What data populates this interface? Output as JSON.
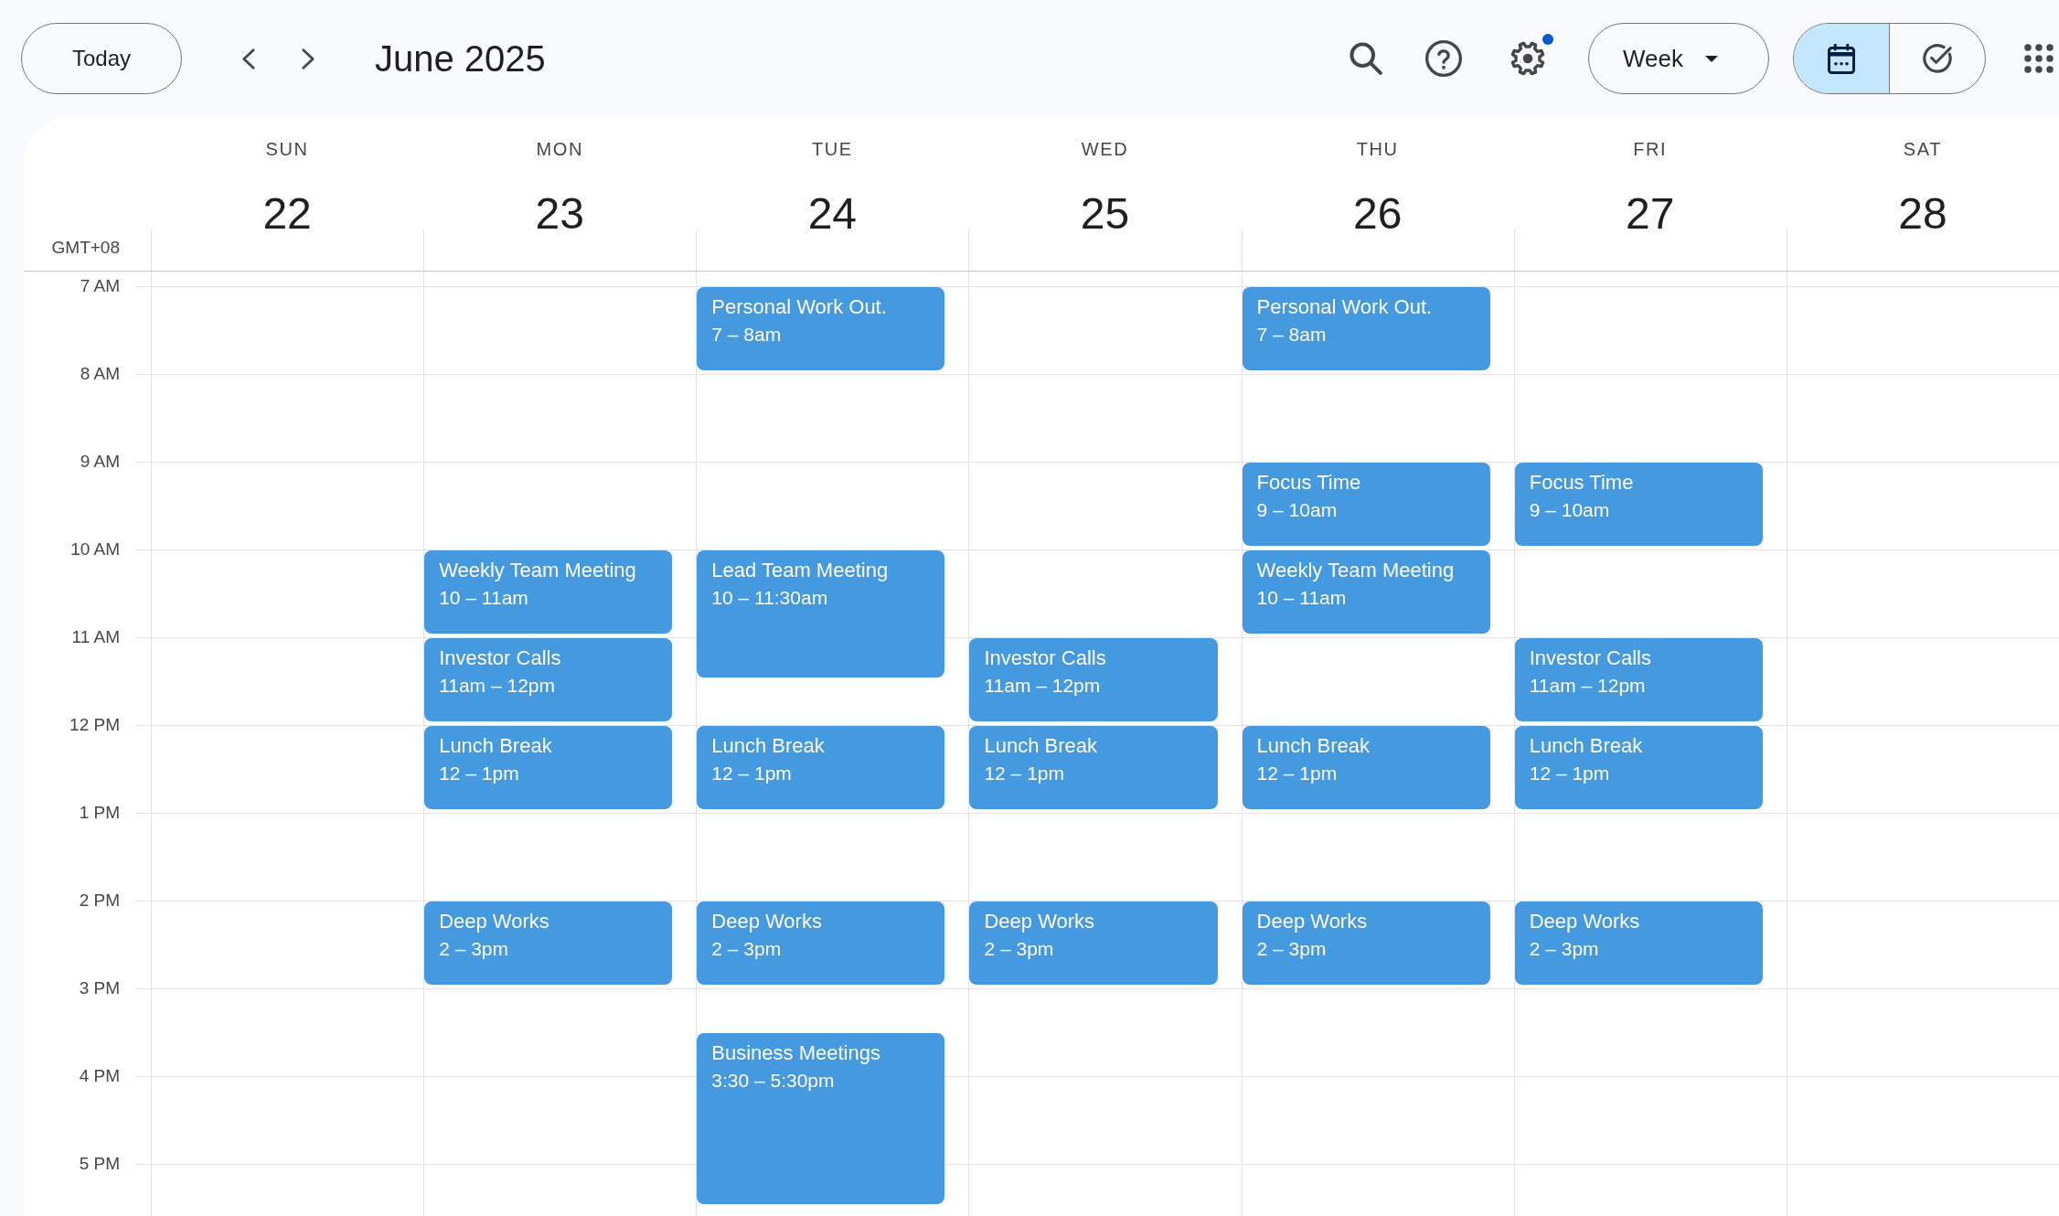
{
  "toolbar": {
    "today_button": "Today",
    "title": "June 2025",
    "settings_badge": true,
    "view_selector": "Week",
    "view_toggle": [
      {
        "kind": "calendar",
        "selected": true
      },
      {
        "kind": "tasks",
        "selected": false
      }
    ]
  },
  "timezone": "GMT+08",
  "hours": [
    "7 AM",
    "8 AM",
    "9 AM",
    "10 AM",
    "11 AM",
    "12 PM",
    "1 PM",
    "2 PM",
    "3 PM",
    "4 PM",
    "5 PM"
  ],
  "days": [
    {
      "weekday": "SUN",
      "date": "22"
    },
    {
      "weekday": "MON",
      "date": "23",
      "events": [
        {
          "title": "Weekly Team Meeting",
          "time": "10 – 11am"
        },
        {
          "title": "Investor Calls",
          "time": "11am – 12pm"
        },
        {
          "title": "Lunch Break",
          "time": "12 – 1pm"
        },
        {
          "title": "Deep Works",
          "time": "2 – 3pm"
        }
      ]
    },
    {
      "weekday": "TUE",
      "date": "24",
      "events": [
        {
          "title": "Personal Work Out.",
          "time": "7 – 8am"
        },
        {
          "title": "Lead Team Meeting",
          "time": "10 – 11:30am"
        },
        {
          "title": "Lunch Break",
          "time": "12 – 1pm"
        },
        {
          "title": "Deep Works",
          "time": "2 – 3pm"
        },
        {
          "title": "Business Meetings",
          "time": "3:30 – 5:30pm"
        }
      ]
    },
    {
      "weekday": "WED",
      "date": "25",
      "events": [
        {
          "title": "Investor Calls",
          "time": "11am – 12pm"
        },
        {
          "title": "Lunch Break",
          "time": "12 – 1pm"
        },
        {
          "title": "Deep Works",
          "time": "2 – 3pm"
        }
      ]
    },
    {
      "weekday": "THU",
      "date": "26",
      "events": [
        {
          "title": "Personal Work Out.",
          "time": "7 – 8am"
        },
        {
          "title": "Focus Time",
          "time": "9 – 10am"
        },
        {
          "title": "Weekly Team Meeting",
          "time": "10 – 11am"
        },
        {
          "title": "Lunch Break",
          "time": "12 – 1pm"
        },
        {
          "title": "Deep Works",
          "time": "2 – 3pm"
        }
      ]
    },
    {
      "weekday": "FRI",
      "date": "27",
      "events": [
        {
          "title": "Focus Time",
          "time": "9 – 10am"
        },
        {
          "title": "Investor Calls",
          "time": "11am – 12pm"
        },
        {
          "title": "Lunch Break",
          "time": "12 – 1pm"
        },
        {
          "title": "Deep Works",
          "time": "2 – 3pm"
        }
      ]
    },
    {
      "weekday": "SAT",
      "date": "28"
    }
  ]
}
